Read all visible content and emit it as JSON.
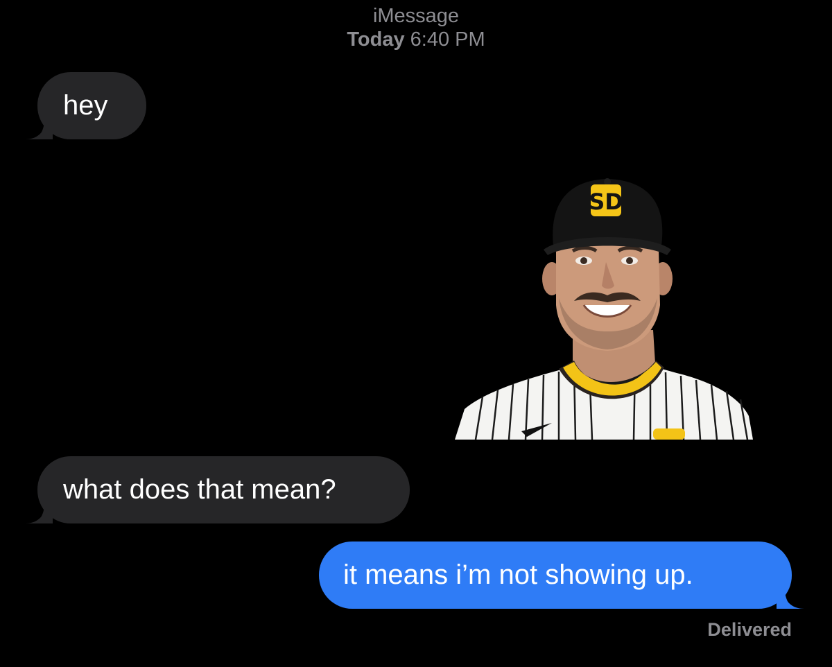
{
  "thread": {
    "service": "iMessage",
    "day": "Today",
    "time": "6:40 PM"
  },
  "messages": [
    {
      "direction": "incoming",
      "text": "hey"
    },
    {
      "direction": "incoming",
      "kind": "photo",
      "text": ""
    },
    {
      "direction": "incoming",
      "text": "what does that mean?"
    },
    {
      "direction": "outgoing",
      "text": "it means i’m not showing up."
    }
  ],
  "status": {
    "delivery": "Delivered"
  },
  "colors": {
    "background": "#000000",
    "incoming_bubble": "#262628",
    "outgoing_bubble": "#2f7cf6",
    "meta_text": "#8e8e93",
    "cap_logo": "#f5c518"
  }
}
